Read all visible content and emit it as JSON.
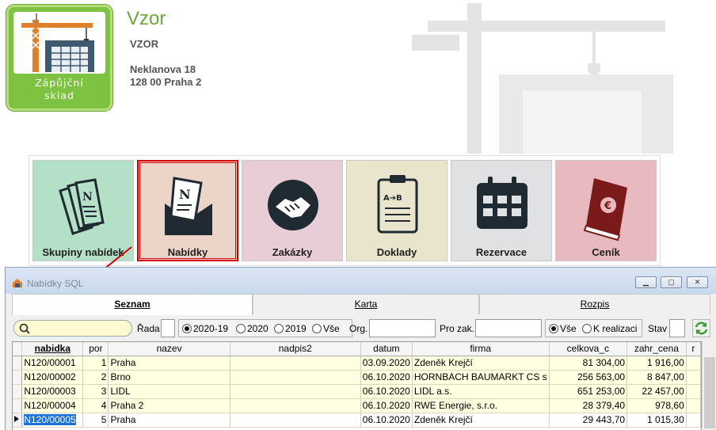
{
  "logo": {
    "line1": "Zápůjční",
    "line2": "sklad"
  },
  "company": {
    "title": "Vzor",
    "code": "VZOR",
    "street": "Neklanova 18",
    "city": "128 00 Praha 2"
  },
  "tiles": [
    {
      "id": "skupiny-nabidek",
      "label": "Skupiny nabídek",
      "color": "#b3e0c6"
    },
    {
      "id": "nabidky",
      "label": "Nabídky",
      "color": "#ecd5c8"
    },
    {
      "id": "zakazky",
      "label": "Zakázky",
      "color": "#e8ccd6"
    },
    {
      "id": "doklady",
      "label": "Doklady",
      "color": "#e9e4cc"
    },
    {
      "id": "rezervace",
      "label": "Rezervace",
      "color": "#dfe1e3"
    },
    {
      "id": "cenik",
      "label": "Ceník",
      "color": "#e8b9bf"
    }
  ],
  "window": {
    "title": "Nabídky SQL"
  },
  "tabs": [
    {
      "label": "Seznam",
      "active": true
    },
    {
      "label": "Karta",
      "active": false
    },
    {
      "label": "Rozpis",
      "active": false
    }
  ],
  "filters": {
    "search_placeholder": "",
    "rada_label": "Řada",
    "rada_value": "",
    "period_options": [
      "2020-19",
      "2020",
      "2019",
      "Vše"
    ],
    "period_selected": "2020-19",
    "org_label": "Org.",
    "org_value": "",
    "prozak_label": "Pro zak.",
    "prozak_value": "",
    "realizace_options": [
      "Vše",
      "K realizaci"
    ],
    "realizace_selected": "Vše",
    "stav_label": "Stav",
    "stav_value": ""
  },
  "grid": {
    "columns": [
      "nabidka",
      "por",
      "nazev",
      "nadpis2",
      "datum",
      "firma",
      "celkova_c",
      "zahr_cena",
      "r"
    ],
    "sorted_column": "nabidka",
    "rows": [
      [
        "N120/00001",
        "1",
        "Praha",
        "",
        "03.09.2020",
        "Zdeněk Krejčí",
        "81 304,00",
        "1 916,00"
      ],
      [
        "N120/00002",
        "2",
        "Brno",
        "",
        "06.10.2020",
        "HORNBACH BAUMARKT CS s",
        "256 563,00",
        "8 847,00"
      ],
      [
        "N120/00003",
        "3",
        "LIDL",
        "",
        "06.10.2020",
        "LIDL a.s.",
        "651 253,00",
        "22 457,00"
      ],
      [
        "N120/00004",
        "4",
        "Praha 2",
        "",
        "06.10.2020",
        "RWE Energie, s.r.o.",
        "28 379,40",
        "978,60"
      ],
      [
        "N120/00005",
        "5",
        "Praha",
        "",
        "06.10.2020",
        "Zdeněk Krejčí",
        "29 443,70",
        "1 015,30"
      ]
    ],
    "current_row": 4
  }
}
